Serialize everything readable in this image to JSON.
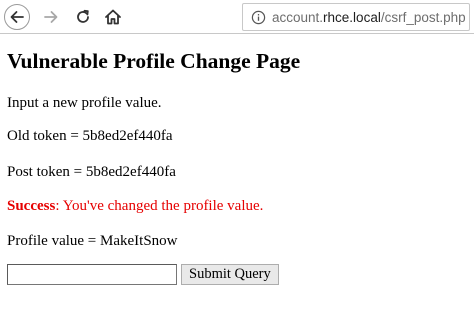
{
  "browser": {
    "url_prefix": "account.",
    "url_host": "rhce.local",
    "url_path": "/csrf_post.php",
    "icons": {
      "back": "back-arrow-icon",
      "forward": "forward-arrow-icon",
      "reload": "reload-icon",
      "home": "home-icon",
      "info": "info-icon"
    }
  },
  "page": {
    "title": "Vulnerable Profile Change Page",
    "instruction": "Input a new profile value.",
    "old_token": "Old token = 5b8ed2ef440fa",
    "post_token": "Post token = 5b8ed2ef440fa",
    "success_label": "Success",
    "success_message": ": You've changed the profile value.",
    "profile_value": "Profile value = MakeItSnow",
    "success_color": "#e60000"
  },
  "form": {
    "input_value": "",
    "submit_label": "Submit Query"
  }
}
